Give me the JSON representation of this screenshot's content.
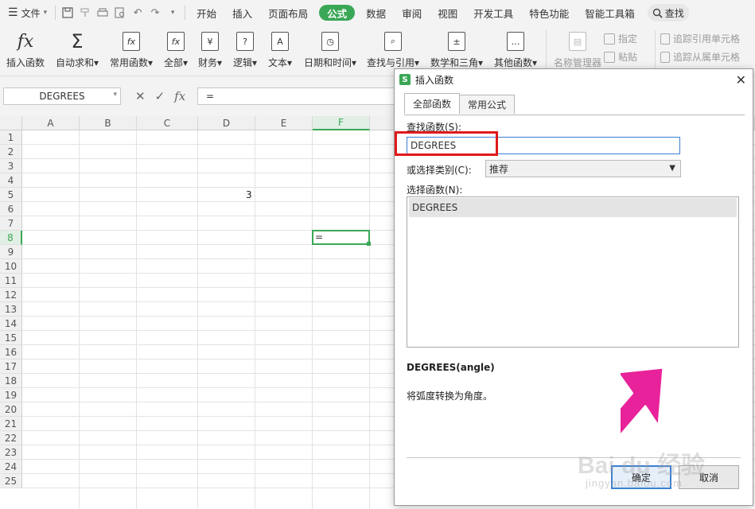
{
  "menubar": {
    "file_label": "文件",
    "tabs": [
      {
        "label": "开始",
        "active": false
      },
      {
        "label": "插入",
        "active": false
      },
      {
        "label": "页面布局",
        "active": false
      },
      {
        "label": "公式",
        "active": true
      },
      {
        "label": "数据",
        "active": false
      },
      {
        "label": "审阅",
        "active": false
      },
      {
        "label": "视图",
        "active": false
      },
      {
        "label": "开发工具",
        "active": false
      },
      {
        "label": "特色功能",
        "active": false
      },
      {
        "label": "智能工具箱",
        "active": false
      }
    ],
    "search_label": "查找"
  },
  "ribbon": {
    "insert_function": "插入函数",
    "autosum": "自动求和",
    "common_functions": "常用函数",
    "all": "全部",
    "finance": "财务",
    "logic": "逻辑",
    "text": "文本",
    "datetime": "日期和时间",
    "lookup": "查找与引用",
    "math": "数学和三角",
    "other": "其他函数",
    "name_manager": "名称管理器",
    "specify": "指定",
    "paste": "粘贴",
    "trace_precedents": "追踪引用单元格",
    "trace_dependents": "追踪从属单元格",
    "fx_glyph": "fx",
    "sum_glyph": "Σ"
  },
  "formulabar": {
    "name_box": "DEGREES",
    "formula": "=",
    "fx_label": "fx"
  },
  "grid": {
    "columns": [
      "A",
      "B",
      "C",
      "D",
      "E",
      "F"
    ],
    "rows": [
      "1",
      "2",
      "3",
      "4",
      "5",
      "6",
      "7",
      "8",
      "9",
      "10",
      "11",
      "12",
      "13",
      "14",
      "15",
      "16",
      "17",
      "18",
      "19",
      "20",
      "21",
      "22",
      "23",
      "24",
      "25"
    ],
    "cell_d5": "3",
    "active_cell_value": "="
  },
  "dialog": {
    "title": "插入函数",
    "logo": "S",
    "tabs": [
      "全部函数",
      "常用公式"
    ],
    "search_label": "查找函数(S):",
    "search_value": "DEGREES",
    "category_label": "或选择类别(C):",
    "category_value": "推荐",
    "list_label": "选择函数(N):",
    "functions": [
      "DEGREES"
    ],
    "signature": "DEGREES(angle)",
    "description": "将弧度转换为角度。",
    "ok_label": "确定",
    "cancel_label": "取消"
  },
  "watermark": {
    "main": "Bai du 经验",
    "sub": "jingyan.baidu.com"
  },
  "colors": {
    "accent_green": "#3aa756",
    "highlight_red": "#e01a1a",
    "pointer_pink": "#e8229a",
    "focus_blue": "#3c7fd1"
  }
}
